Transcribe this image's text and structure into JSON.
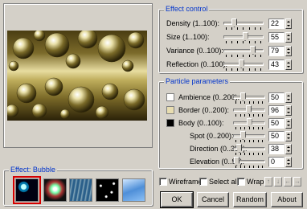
{
  "effect_control": {
    "title": "Effect control",
    "params": [
      {
        "label": "Density (1..100):",
        "value": "22",
        "pos": 0.22
      },
      {
        "label": "Size (1..100):",
        "value": "55",
        "pos": 0.55
      },
      {
        "label": "Variance (0..100):",
        "value": "79",
        "pos": 0.79
      },
      {
        "label": "Reflection (0..100):",
        "value": "43",
        "pos": 0.43
      }
    ]
  },
  "particle_parameters": {
    "title": "Particle parameters",
    "params": [
      {
        "label": "Ambience (0..200):",
        "value": "50",
        "pos": 0.25,
        "swatch": "#ffffff"
      },
      {
        "label": "Border (0..200):",
        "value": "96",
        "pos": 0.48,
        "swatch": "#e8ddb0"
      },
      {
        "label": "Body (0..100):",
        "value": "50",
        "pos": 0.5,
        "swatch": "#000000"
      },
      {
        "label": "Spot (0..200):",
        "value": "50",
        "pos": 0.25
      },
      {
        "label": "Direction (0..359):",
        "value": "38",
        "pos": 0.11
      },
      {
        "label": "Elevation (0..90):",
        "value": "0",
        "pos": 0.0
      }
    ]
  },
  "effect_group": {
    "title": "Effect: Bubble"
  },
  "checkboxes": {
    "wireframe": "Wireframe",
    "select_all": "Select all",
    "wrap": "Wrap"
  },
  "buttons": {
    "ok": "OK",
    "cancel": "Cancel",
    "random": "Random",
    "about": "About"
  }
}
